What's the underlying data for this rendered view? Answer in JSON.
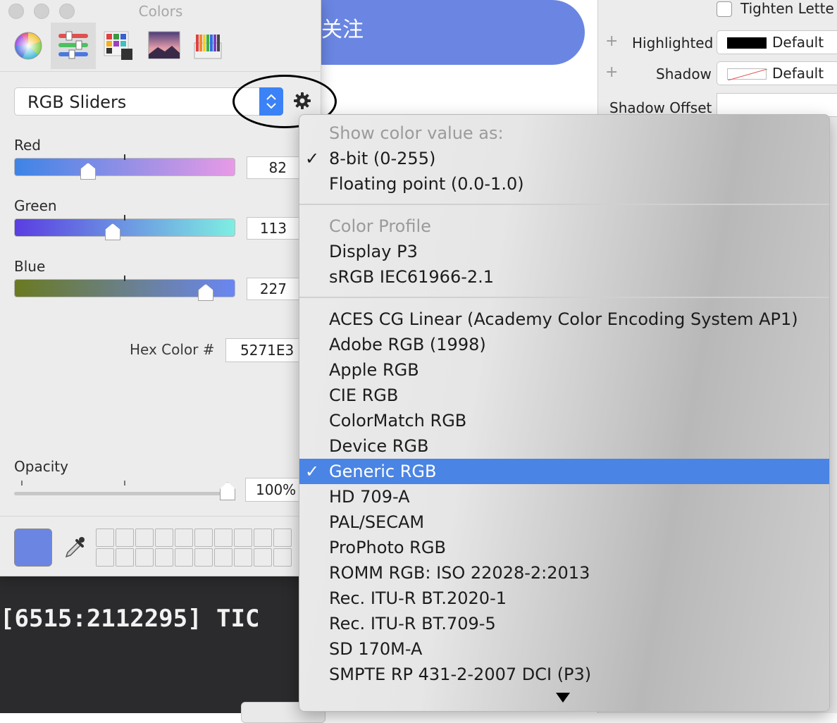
{
  "colors": {
    "accent": "#6a86e2",
    "menu_highlight": "#4a84e4",
    "current_color_hex": "#5271E3"
  },
  "background_app": {
    "follow_button": "关注",
    "inspector": {
      "tighten_label": "Tighten Lette",
      "highlighted_label": "Highlighted",
      "highlighted_value": "Default",
      "shadow_label": "Shadow",
      "shadow_value": "Default",
      "shadow_offset_label": "Shadow Offset"
    },
    "console_text": "[6515:2112295] TIC "
  },
  "panel": {
    "title": "Colors",
    "toolbar": [
      "color-wheel-icon",
      "sliders-icon",
      "palettes-icon",
      "image-palette-icon",
      "pencils-icon"
    ],
    "mode": "RGB Sliders",
    "sliders": [
      {
        "label": "Red",
        "value": "82",
        "fraction": 0.32
      },
      {
        "label": "Green",
        "value": "113",
        "fraction": 0.44
      },
      {
        "label": "Blue",
        "value": "227",
        "fraction": 0.89
      }
    ],
    "hex_label": "Hex Color #",
    "hex_value": "5271E3",
    "opacity_label": "Opacity",
    "opacity_value": "100%"
  },
  "menu": {
    "sections": [
      {
        "header": "Show color value as:",
        "items": [
          {
            "label": "8-bit (0-255)",
            "checked": true
          },
          {
            "label": "Floating point (0.0-1.0)"
          }
        ]
      },
      {
        "header": "Color Profile",
        "items": [
          {
            "label": "Display P3"
          },
          {
            "label": "sRGB IEC61966-2.1"
          }
        ]
      },
      {
        "header": "",
        "items": [
          {
            "label": "ACES CG Linear (Academy Color Encoding System AP1)"
          },
          {
            "label": "Adobe RGB (1998)"
          },
          {
            "label": "Apple RGB"
          },
          {
            "label": "CIE RGB"
          },
          {
            "label": "ColorMatch RGB"
          },
          {
            "label": "Device RGB"
          },
          {
            "label": "Generic RGB",
            "checked": true,
            "selected": true
          },
          {
            "label": "HD 709-A"
          },
          {
            "label": "PAL/SECAM"
          },
          {
            "label": "ProPhoto RGB"
          },
          {
            "label": "ROMM RGB: ISO 22028-2:2013"
          },
          {
            "label": "Rec. ITU-R BT.2020-1"
          },
          {
            "label": "Rec. ITU-R BT.709-5"
          },
          {
            "label": "SD 170M-A"
          },
          {
            "label": "SMPTE RP 431-2-2007 DCI (P3)"
          }
        ]
      }
    ]
  }
}
